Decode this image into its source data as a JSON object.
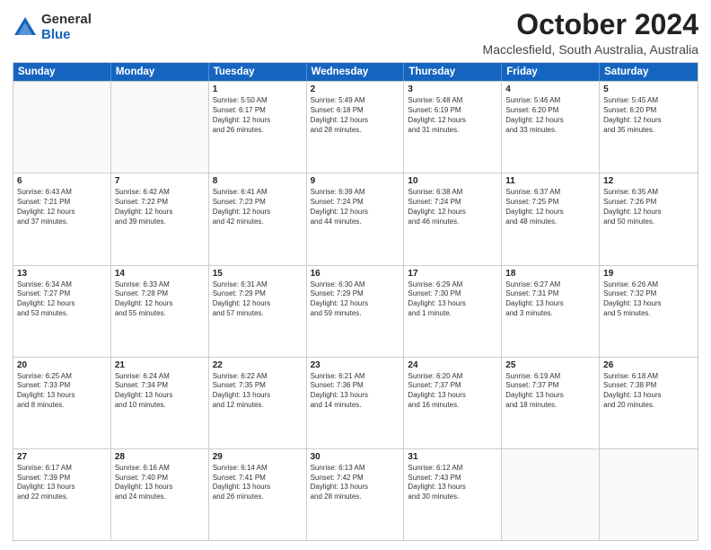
{
  "logo": {
    "general": "General",
    "blue": "Blue"
  },
  "header": {
    "month": "October 2024",
    "location": "Macclesfield, South Australia, Australia"
  },
  "days": [
    "Sunday",
    "Monday",
    "Tuesday",
    "Wednesday",
    "Thursday",
    "Friday",
    "Saturday"
  ],
  "weeks": [
    [
      {
        "day": "",
        "content": ""
      },
      {
        "day": "",
        "content": ""
      },
      {
        "day": "1",
        "content": "Sunrise: 5:50 AM\nSunset: 6:17 PM\nDaylight: 12 hours\nand 26 minutes."
      },
      {
        "day": "2",
        "content": "Sunrise: 5:49 AM\nSunset: 6:18 PM\nDaylight: 12 hours\nand 28 minutes."
      },
      {
        "day": "3",
        "content": "Sunrise: 5:48 AM\nSunset: 6:19 PM\nDaylight: 12 hours\nand 31 minutes."
      },
      {
        "day": "4",
        "content": "Sunrise: 5:46 AM\nSunset: 6:20 PM\nDaylight: 12 hours\nand 33 minutes."
      },
      {
        "day": "5",
        "content": "Sunrise: 5:45 AM\nSunset: 6:20 PM\nDaylight: 12 hours\nand 35 minutes."
      }
    ],
    [
      {
        "day": "6",
        "content": "Sunrise: 6:43 AM\nSunset: 7:21 PM\nDaylight: 12 hours\nand 37 minutes."
      },
      {
        "day": "7",
        "content": "Sunrise: 6:42 AM\nSunset: 7:22 PM\nDaylight: 12 hours\nand 39 minutes."
      },
      {
        "day": "8",
        "content": "Sunrise: 6:41 AM\nSunset: 7:23 PM\nDaylight: 12 hours\nand 42 minutes."
      },
      {
        "day": "9",
        "content": "Sunrise: 6:39 AM\nSunset: 7:24 PM\nDaylight: 12 hours\nand 44 minutes."
      },
      {
        "day": "10",
        "content": "Sunrise: 6:38 AM\nSunset: 7:24 PM\nDaylight: 12 hours\nand 46 minutes."
      },
      {
        "day": "11",
        "content": "Sunrise: 6:37 AM\nSunset: 7:25 PM\nDaylight: 12 hours\nand 48 minutes."
      },
      {
        "day": "12",
        "content": "Sunrise: 6:35 AM\nSunset: 7:26 PM\nDaylight: 12 hours\nand 50 minutes."
      }
    ],
    [
      {
        "day": "13",
        "content": "Sunrise: 6:34 AM\nSunset: 7:27 PM\nDaylight: 12 hours\nand 53 minutes."
      },
      {
        "day": "14",
        "content": "Sunrise: 6:33 AM\nSunset: 7:28 PM\nDaylight: 12 hours\nand 55 minutes."
      },
      {
        "day": "15",
        "content": "Sunrise: 6:31 AM\nSunset: 7:29 PM\nDaylight: 12 hours\nand 57 minutes."
      },
      {
        "day": "16",
        "content": "Sunrise: 6:30 AM\nSunset: 7:29 PM\nDaylight: 12 hours\nand 59 minutes."
      },
      {
        "day": "17",
        "content": "Sunrise: 6:29 AM\nSunset: 7:30 PM\nDaylight: 13 hours\nand 1 minute."
      },
      {
        "day": "18",
        "content": "Sunrise: 6:27 AM\nSunset: 7:31 PM\nDaylight: 13 hours\nand 3 minutes."
      },
      {
        "day": "19",
        "content": "Sunrise: 6:26 AM\nSunset: 7:32 PM\nDaylight: 13 hours\nand 5 minutes."
      }
    ],
    [
      {
        "day": "20",
        "content": "Sunrise: 6:25 AM\nSunset: 7:33 PM\nDaylight: 13 hours\nand 8 minutes."
      },
      {
        "day": "21",
        "content": "Sunrise: 6:24 AM\nSunset: 7:34 PM\nDaylight: 13 hours\nand 10 minutes."
      },
      {
        "day": "22",
        "content": "Sunrise: 6:22 AM\nSunset: 7:35 PM\nDaylight: 13 hours\nand 12 minutes."
      },
      {
        "day": "23",
        "content": "Sunrise: 6:21 AM\nSunset: 7:36 PM\nDaylight: 13 hours\nand 14 minutes."
      },
      {
        "day": "24",
        "content": "Sunrise: 6:20 AM\nSunset: 7:37 PM\nDaylight: 13 hours\nand 16 minutes."
      },
      {
        "day": "25",
        "content": "Sunrise: 6:19 AM\nSunset: 7:37 PM\nDaylight: 13 hours\nand 18 minutes."
      },
      {
        "day": "26",
        "content": "Sunrise: 6:18 AM\nSunset: 7:38 PM\nDaylight: 13 hours\nand 20 minutes."
      }
    ],
    [
      {
        "day": "27",
        "content": "Sunrise: 6:17 AM\nSunset: 7:39 PM\nDaylight: 13 hours\nand 22 minutes."
      },
      {
        "day": "28",
        "content": "Sunrise: 6:16 AM\nSunset: 7:40 PM\nDaylight: 13 hours\nand 24 minutes."
      },
      {
        "day": "29",
        "content": "Sunrise: 6:14 AM\nSunset: 7:41 PM\nDaylight: 13 hours\nand 26 minutes."
      },
      {
        "day": "30",
        "content": "Sunrise: 6:13 AM\nSunset: 7:42 PM\nDaylight: 13 hours\nand 28 minutes."
      },
      {
        "day": "31",
        "content": "Sunrise: 6:12 AM\nSunset: 7:43 PM\nDaylight: 13 hours\nand 30 minutes."
      },
      {
        "day": "",
        "content": ""
      },
      {
        "day": "",
        "content": ""
      }
    ]
  ]
}
